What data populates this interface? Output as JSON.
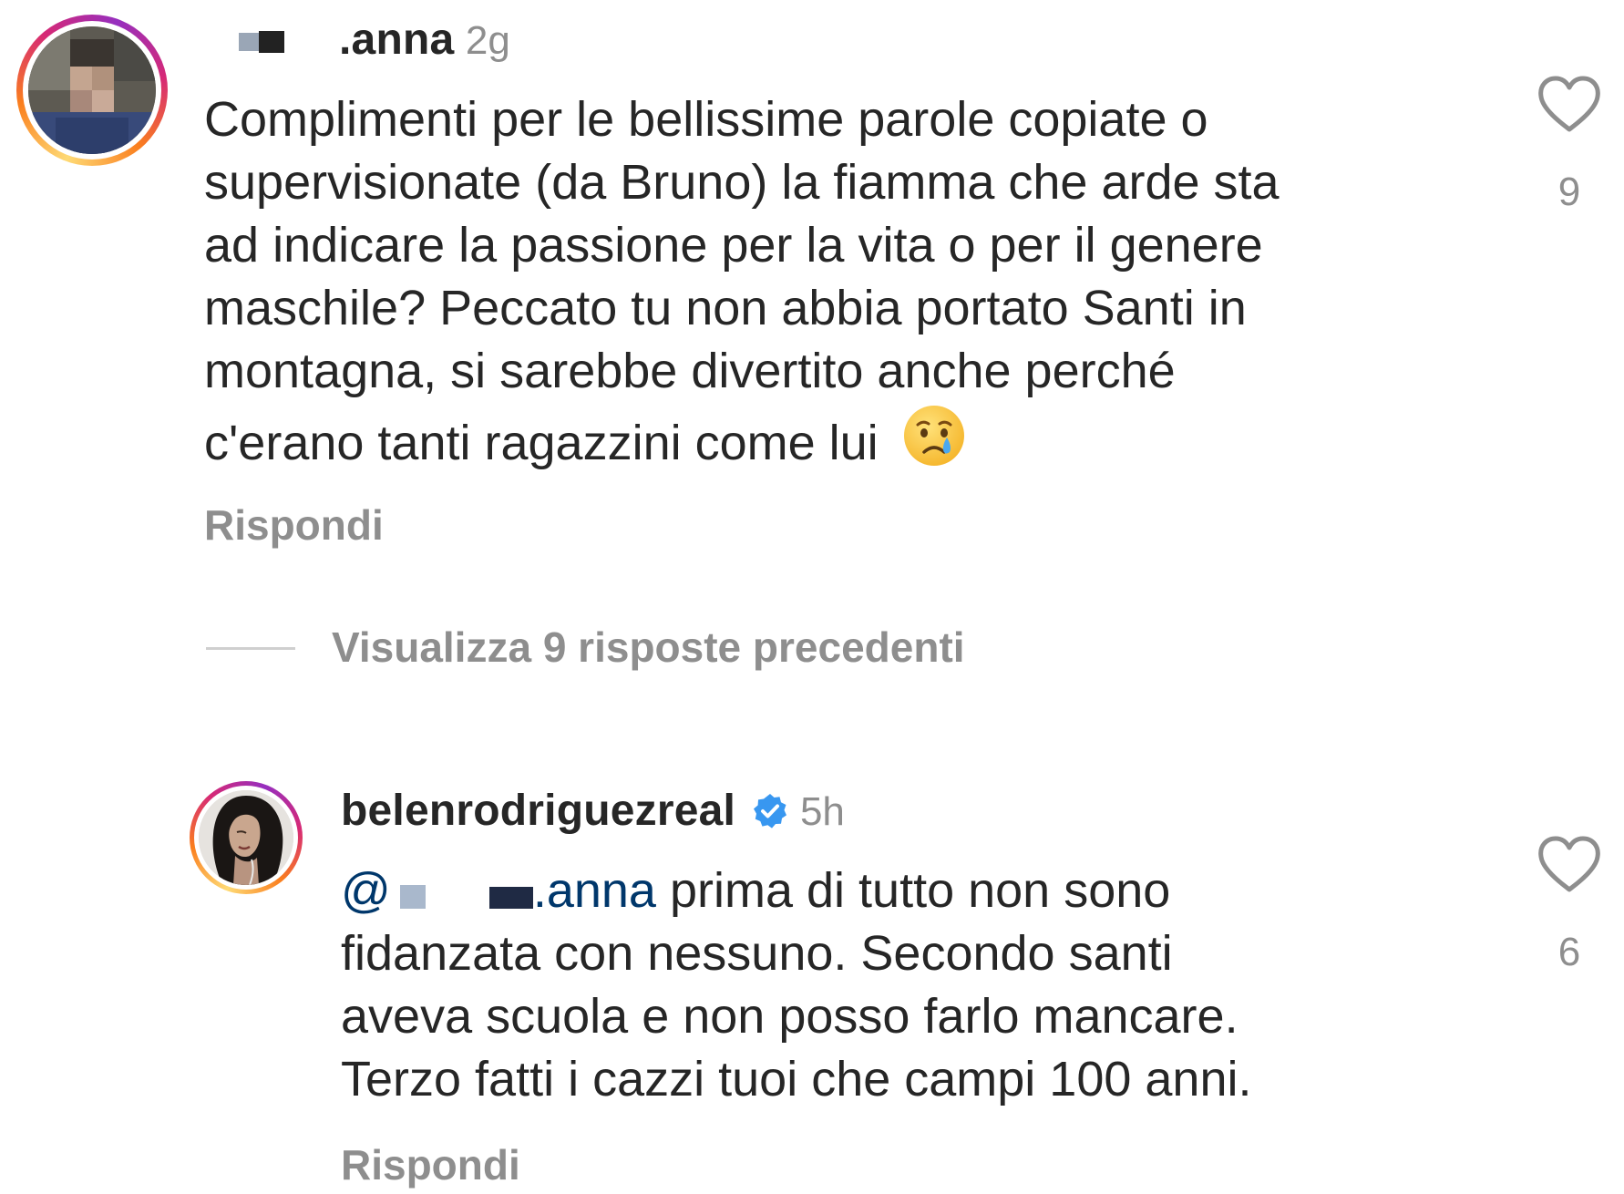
{
  "comment1": {
    "username_suffix": "anna",
    "username_dot": ".",
    "time": "2g",
    "lines": [
      "Complimenti per le bellissime parole copiate o",
      "supervisionate (da Bruno) la fiamma che arde sta",
      "ad indicare la passione per la vita o per il genere",
      "maschile? Peccato tu non abbia portato Santi in",
      "montagna, si sarebbe divertito anche perché",
      "c'erano tanti ragazzini come lui"
    ],
    "emoji": "😢",
    "likes": "9",
    "reply_label": "Rispondi"
  },
  "view_replies": "Visualizza 9 risposte precedenti",
  "comment2": {
    "username": "belenrodriguezreal",
    "time": "5h",
    "mention_prefix": "@",
    "mention_suffix": ".anna",
    "line1_rest": " prima di tutto non sono",
    "lines": [
      "fidanzata con nessuno. Secondo santi",
      "aveva scuola e non posso farlo mancare.",
      "Terzo fatti i cazzi tuoi che campi 100 anni."
    ],
    "likes": "6",
    "reply_label": "Rispondi"
  },
  "colors": {
    "text": "#262626",
    "secondary": "#8e8e8e",
    "mention": "#00376b",
    "verified": "#3897f0"
  },
  "icons": [
    "heart-outline-icon",
    "verified-badge-icon"
  ]
}
